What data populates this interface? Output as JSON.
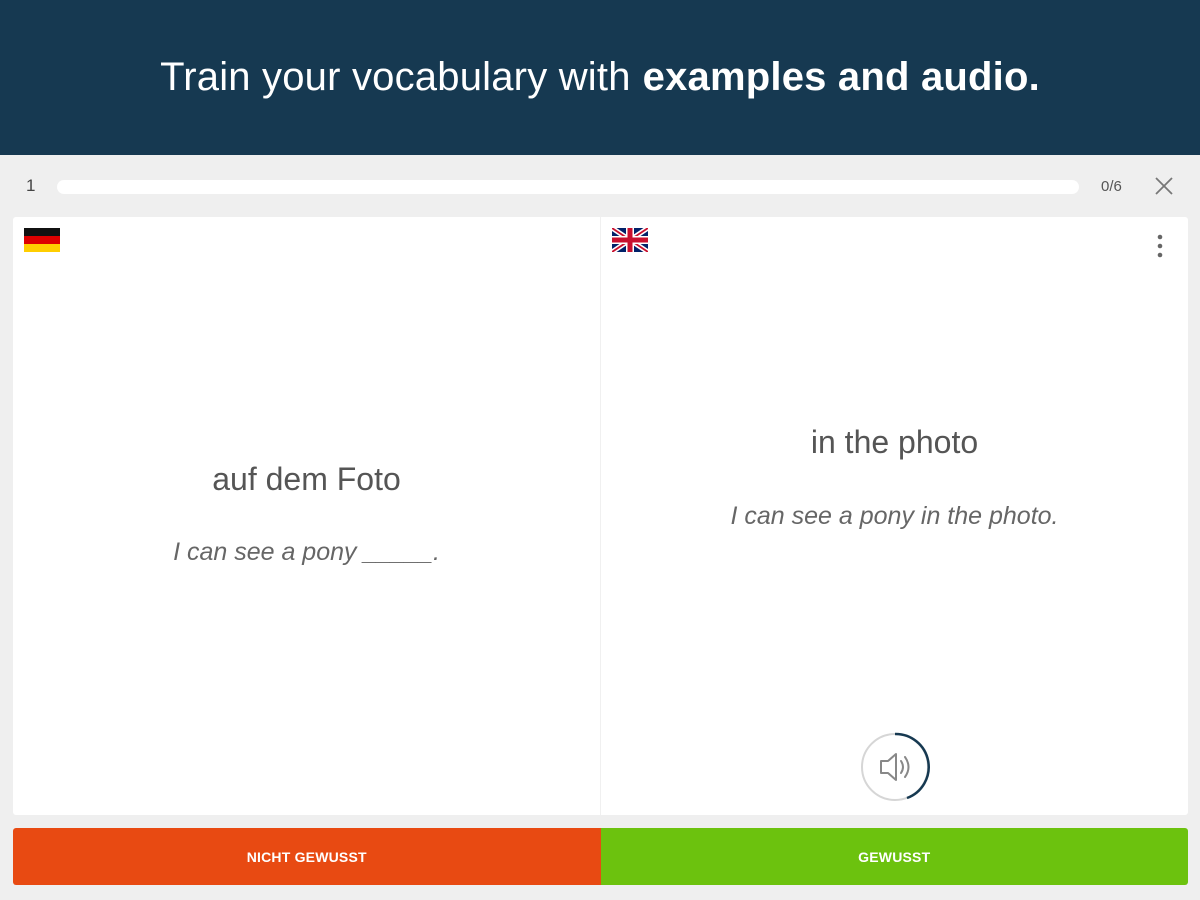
{
  "banner": {
    "text_plain": "Train your vocabulary with",
    "text_bold": "examples and audio."
  },
  "progress": {
    "card_number": "1",
    "counter": "0/6",
    "value": 0,
    "close_icon": "close-icon"
  },
  "left_pane": {
    "flag_icon": "flag-germany-icon",
    "term": "auf dem Foto",
    "example": "I can see a pony _____."
  },
  "right_pane": {
    "flag_icon": "flag-uk-icon",
    "term": "in the photo",
    "example": "I can see a pony in the photo.",
    "menu_icon": "more-vertical-icon",
    "audio_icon": "speaker-icon"
  },
  "answers": {
    "unknown_label": "NICHT GEWUSST",
    "known_label": "GEWUSST"
  },
  "colors": {
    "banner": "#163951",
    "unknown": "#e84a12",
    "known": "#6cc20e",
    "audio_ring_accent": "#163951"
  }
}
